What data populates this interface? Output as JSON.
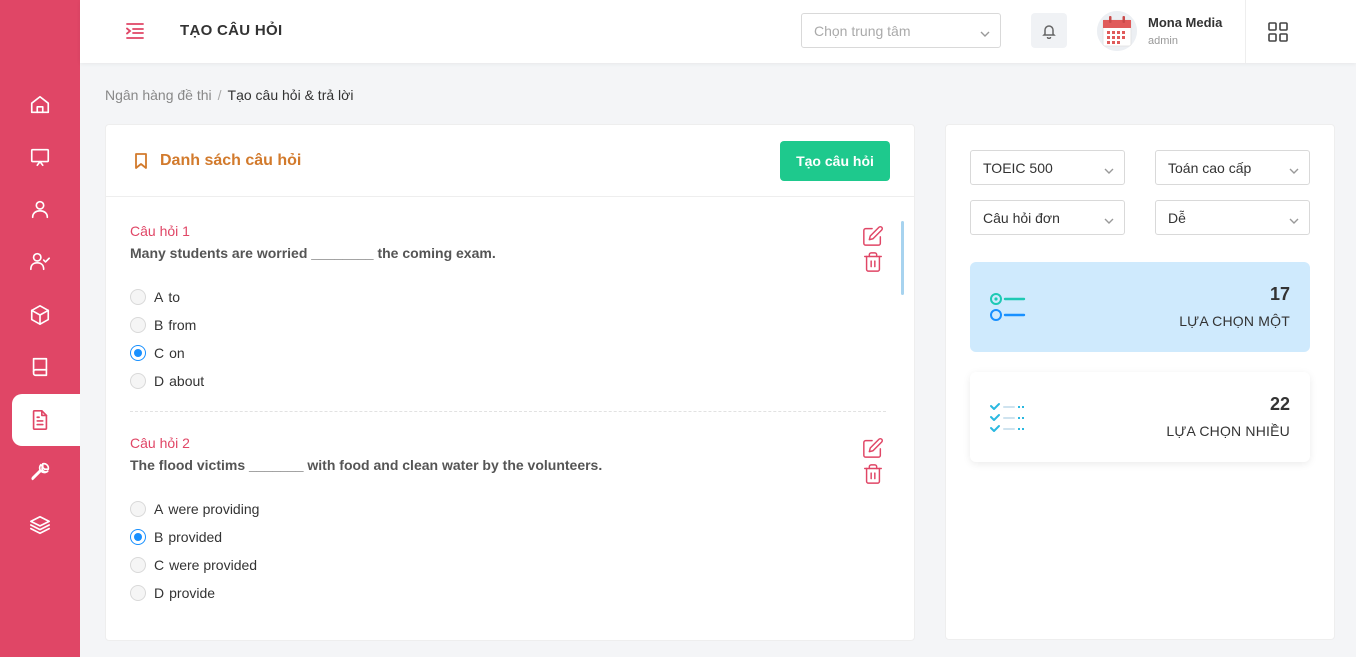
{
  "header": {
    "title": "TẠO CÂU HỎI",
    "center_select_placeholder": "Chọn trung tâm",
    "user_name": "Mona Media",
    "user_role": "admin"
  },
  "sidebar": {
    "items": [
      {
        "icon": "home-icon"
      },
      {
        "icon": "monitor-icon"
      },
      {
        "icon": "user-icon"
      },
      {
        "icon": "user-check-icon"
      },
      {
        "icon": "box-icon"
      },
      {
        "icon": "book-icon"
      },
      {
        "icon": "file-text-icon",
        "active": true
      },
      {
        "icon": "tool-icon"
      },
      {
        "icon": "layers-icon"
      }
    ],
    "accent": "#e04666"
  },
  "breadcrumb": {
    "parent": "Ngân hàng đề thi",
    "separator": "/",
    "current": "Tạo câu hỏi & trả lời"
  },
  "question_list": {
    "title": "Danh sách câu hỏi",
    "create_button": "Tạo câu hỏi",
    "questions": [
      {
        "label": "Câu hỏi 1",
        "text": "Many students are worried ________ the coming exam.",
        "options": [
          {
            "letter": "A",
            "text": "to",
            "checked": false
          },
          {
            "letter": "B",
            "text": "from",
            "checked": false
          },
          {
            "letter": "C",
            "text": "on",
            "checked": true
          },
          {
            "letter": "D",
            "text": "about",
            "checked": false
          }
        ]
      },
      {
        "label": "Câu hỏi 2",
        "text": "The flood victims _______ with food and clean water by the volunteers.",
        "options": [
          {
            "letter": "A",
            "text": "were providing",
            "checked": false
          },
          {
            "letter": "B",
            "text": "provided",
            "checked": true
          },
          {
            "letter": "C",
            "text": "were provided",
            "checked": false
          },
          {
            "letter": "D",
            "text": "provide",
            "checked": false
          }
        ]
      }
    ]
  },
  "filters": {
    "exam": "TOEIC 500",
    "subject": "Toán cao cấp",
    "question_type": "Câu hỏi đơn",
    "level": "Dễ"
  },
  "stats": {
    "single_choice": {
      "count": "17",
      "label": "LỰA CHỌN MỘT"
    },
    "multi_choice": {
      "count": "22",
      "label": "LỰA CHỌN NHIỀU"
    }
  },
  "colors": {
    "primary": "#e04666",
    "success": "#1ec98d",
    "title_orange": "#d27a2c",
    "radio_blue": "#1890ff",
    "stat_single_bg": "#cfeafd"
  }
}
